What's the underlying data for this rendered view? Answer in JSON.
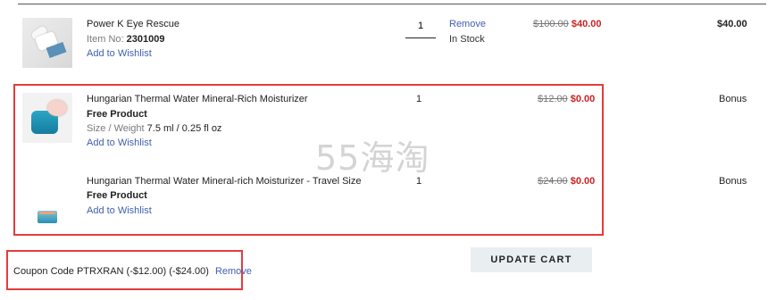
{
  "cart": {
    "items": [
      {
        "name": "Power K Eye Rescue",
        "item_no_label": "Item No:",
        "item_no": "2301009",
        "wishlist": "Add to Wishlist",
        "qty": "1",
        "remove": "Remove",
        "stock": "In Stock",
        "orig_price": "$100.00",
        "sale_price": "$40.00",
        "total": "$40.00"
      },
      {
        "name": "Hungarian Thermal Water Mineral-Rich Moisturizer",
        "free": "Free Product",
        "size_label": "Size / Weight",
        "size": "7.5 ml / 0.25 fl oz",
        "wishlist": "Add to Wishlist",
        "qty": "1",
        "orig_price": "$12.00",
        "sale_price": "$0.00",
        "total": "Bonus"
      },
      {
        "name": "Hungarian Thermal Water Mineral-rich Moisturizer - Travel Size",
        "free": "Free Product",
        "wishlist": "Add to Wishlist",
        "qty": "1",
        "orig_price": "$24.00",
        "sale_price": "$0.00",
        "total": "Bonus"
      }
    ]
  },
  "watermark": "55海淘",
  "coupon": {
    "text": "Coupon Code PTRXRAN (-$12.00) (-$24.00)",
    "remove": "Remove"
  },
  "update_button": "UPDATE CART",
  "colors": {
    "highlight_border": "#e43c3c",
    "sale_price": "#cc2222",
    "link": "#3f5fb0"
  }
}
